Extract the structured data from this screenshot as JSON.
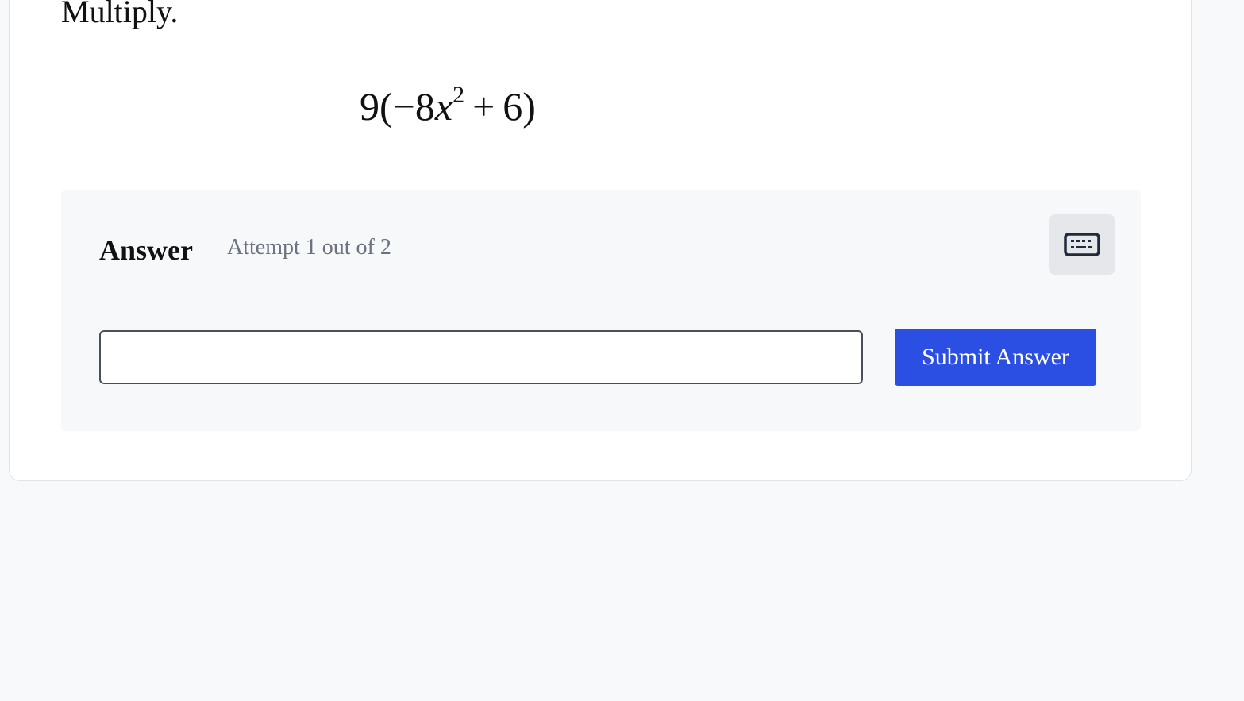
{
  "question": {
    "prompt": "Multiply.",
    "expression": {
      "coefficient": "9",
      "open_paren": "(",
      "negative_coefficient": "−8",
      "variable": "x",
      "exponent": "2",
      "operator": "+",
      "constant": "6",
      "close_paren": ")"
    }
  },
  "answer": {
    "label": "Answer",
    "attempt_text": "Attempt 1 out of 2",
    "input_value": "",
    "input_placeholder": "",
    "submit_label": "Submit Answer",
    "keyboard_icon": "keyboard-icon"
  },
  "colors": {
    "submit_button": "#2b4fe3",
    "panel_background": "#f7f8fa",
    "page_background": "#f8f9fb",
    "muted_text": "#6b7280"
  }
}
